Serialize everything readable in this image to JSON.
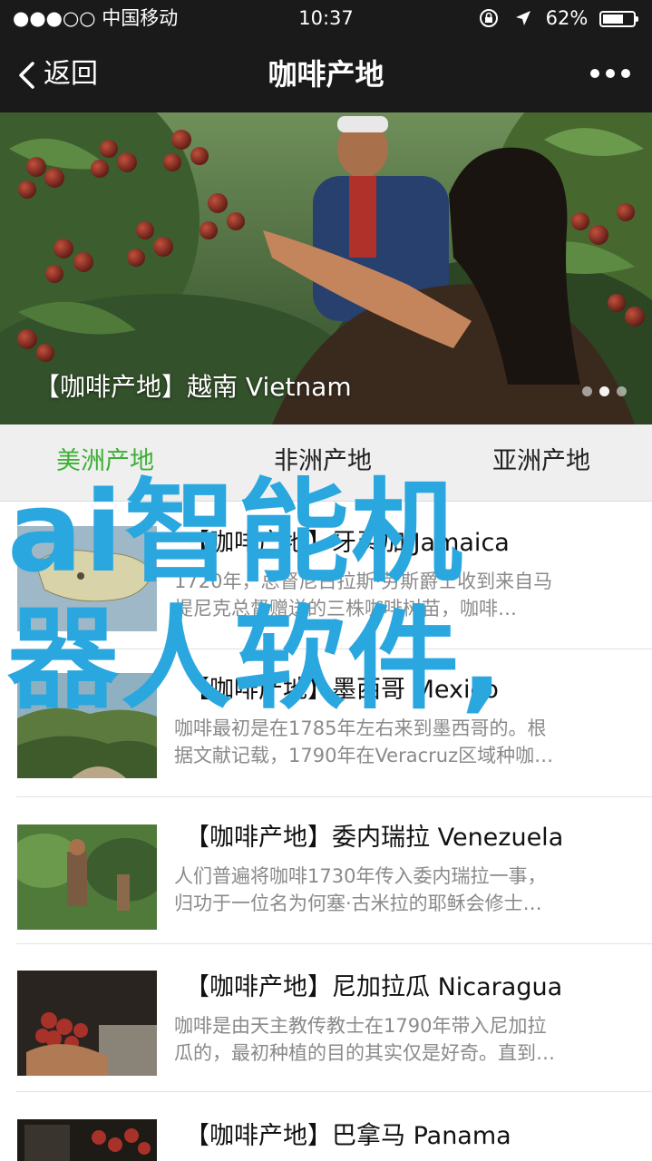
{
  "status_bar": {
    "carrier": "●●●○○ 中国移动",
    "time": "10:37",
    "right": "62%"
  },
  "nav": {
    "back_label": "返回",
    "title": "咖啡产地"
  },
  "hero": {
    "caption": "【咖啡产地】越南 Vietnam",
    "dots": 3,
    "active_dot": 1
  },
  "tabs": [
    {
      "label": "美洲产地",
      "active": true
    },
    {
      "label": "非洲产地",
      "active": false
    },
    {
      "label": "亚洲产地",
      "active": false
    }
  ],
  "items": [
    {
      "title": "【咖啡产地】牙买加 Jamaica",
      "desc_line1": "1720年，总督尼古拉斯·劳斯爵士收到来自马",
      "desc_line2": "提尼克总督赠送的三株咖啡树苗，咖啡…"
    },
    {
      "title": "【咖啡产地】墨西哥 Mexico",
      "desc_line1": "咖啡最初是在1785年左右来到墨西哥的。根",
      "desc_line2": "据文献记载，1790年在Veracruz区域种咖…"
    },
    {
      "title": "【咖啡产地】委内瑞拉 Venezuela",
      "desc_line1": "人们普遍将咖啡1730年传入委内瑞拉一事，",
      "desc_line2": "归功于一位名为何塞·古米拉的耶稣会修士…"
    },
    {
      "title": "【咖啡产地】尼加拉瓜 Nicaragua",
      "desc_line1": "咖啡是由天主教传教士在1790年带入尼加拉",
      "desc_line2": "瓜的，最初种植的目的其实仅是好奇。直到…"
    },
    {
      "title": "【咖啡产地】巴拿马 Panama",
      "desc_line1": "",
      "desc_line2": ""
    }
  ],
  "overlay": {
    "line1": "ai智能机",
    "line2": "器人软件,"
  },
  "colors": {
    "accent": "#3cb034",
    "overlay": "#2aa7df",
    "bar": "#1a1a1a"
  }
}
